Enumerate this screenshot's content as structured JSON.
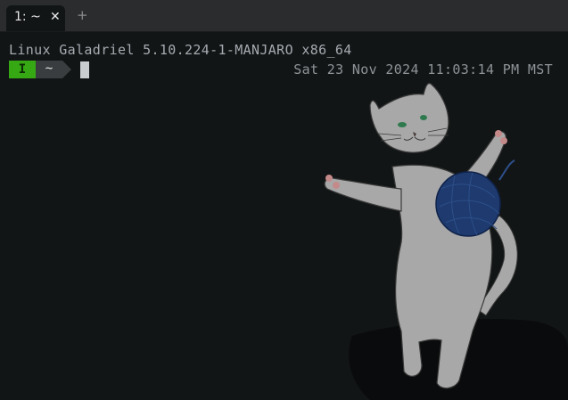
{
  "tabbar": {
    "tabs": [
      {
        "title": "1: ~",
        "close_glyph": "✕"
      }
    ],
    "new_tab_glyph": "+"
  },
  "terminal": {
    "motd": "Linux Galadriel 5.10.224-1-MANJARO x86_64",
    "prompt": {
      "mode": "I",
      "directory": "~"
    },
    "datetime": "Sat 23 Nov 2024 11:03:14 PM MST"
  },
  "background": {
    "image": "cat-with-yarn-ball",
    "colors": {
      "bg": "#121516",
      "cat": "#a8a8a8",
      "yarn": "#1e3a6e"
    }
  },
  "colors": {
    "mode_segment": "#35a814",
    "dir_segment": "#3a3d3f",
    "text": "#a6abb0"
  }
}
